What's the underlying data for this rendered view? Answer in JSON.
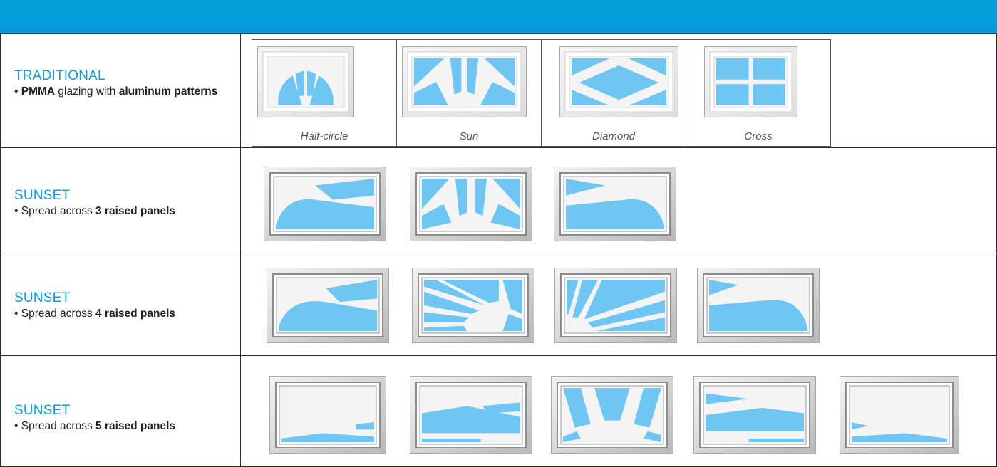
{
  "header": {
    "color": "#049ddb"
  },
  "rows": [
    {
      "title": "TRADITIONAL",
      "bullet": "•",
      "desc_parts": [
        "PMMA",
        " glazing with ",
        "aluminum patterns"
      ],
      "windows": [
        {
          "pattern": "half-circle",
          "caption": "Half-circle"
        },
        {
          "pattern": "sun",
          "caption": "Sun"
        },
        {
          "pattern": "diamond",
          "caption": "Diamond"
        },
        {
          "pattern": "cross",
          "caption": "Cross"
        }
      ]
    },
    {
      "title": "SUNSET",
      "bullet": "•",
      "desc_parts": [
        "Spread across ",
        "3 raised panels"
      ],
      "windows": [
        {
          "pattern": "sunset-3-left"
        },
        {
          "pattern": "sunset-3-center"
        },
        {
          "pattern": "sunset-3-right"
        }
      ]
    },
    {
      "title": "SUNSET",
      "bullet": "•",
      "desc_parts": [
        "Spread across ",
        "4 raised panels"
      ],
      "windows": [
        {
          "pattern": "sunset-4-1"
        },
        {
          "pattern": "sunset-4-2"
        },
        {
          "pattern": "sunset-4-3"
        },
        {
          "pattern": "sunset-4-4"
        }
      ]
    },
    {
      "title": "SUNSET",
      "bullet": "•",
      "desc_parts": [
        "Spread across ",
        "5 raised panels"
      ],
      "windows": [
        {
          "pattern": "sunset-5-1"
        },
        {
          "pattern": "sunset-5-2"
        },
        {
          "pattern": "sunset-5-3"
        },
        {
          "pattern": "sunset-5-4"
        },
        {
          "pattern": "sunset-5-5"
        }
      ]
    }
  ],
  "colors": {
    "glass": "#6fc6f2",
    "glass_dark": "#5bbde9",
    "title": "#0a9fd8",
    "frame": "#e9e9e9"
  }
}
